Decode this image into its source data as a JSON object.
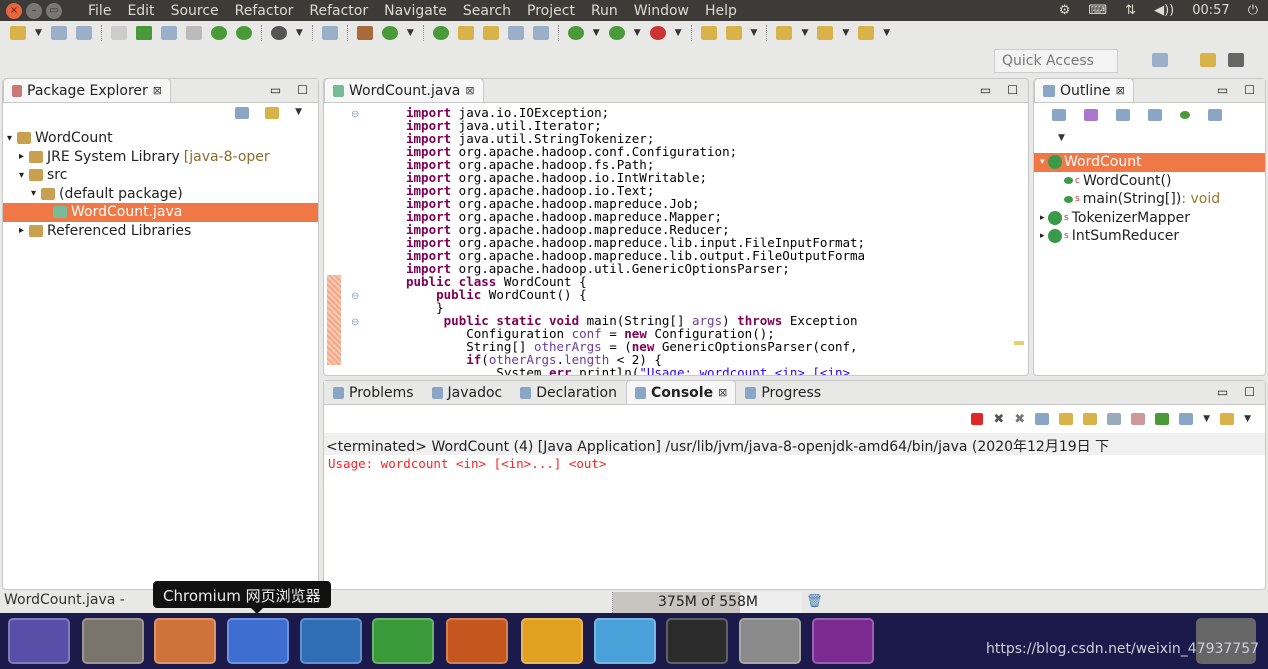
{
  "window": {
    "close": "×",
    "minimize": "–",
    "maximize": "▭"
  },
  "menu": [
    "File",
    "Edit",
    "Source",
    "Refactor",
    "Refactor",
    "Navigate",
    "Search",
    "Project",
    "Run",
    "Window",
    "Help"
  ],
  "tray": {
    "clock": "00:57",
    "volume": "◀))"
  },
  "quick_access": {
    "placeholder": "Quick Access"
  },
  "package_explorer": {
    "title": "Package Explorer",
    "tree": [
      {
        "label": "WordCount",
        "indent": 0,
        "arrow": "▾"
      },
      {
        "label": "JRE System Library",
        "suffix": "[java-8-oper",
        "indent": 1,
        "arrow": "▸"
      },
      {
        "label": "src",
        "indent": 1,
        "arrow": "▾"
      },
      {
        "label": "(default package)",
        "indent": 2,
        "arrow": "▾"
      },
      {
        "label": "WordCount.java",
        "indent": 3,
        "arrow": "",
        "selected": true
      },
      {
        "label": "Referenced Libraries",
        "indent": 1,
        "arrow": "▸"
      }
    ]
  },
  "editor": {
    "tab": "WordCount.java",
    "lines": [
      [
        [
          "kw",
          "import"
        ],
        [
          "pl",
          " java.io.IOException;"
        ]
      ],
      [
        [
          "kw",
          "import"
        ],
        [
          "pl",
          " java.util.Iterator;"
        ]
      ],
      [
        [
          "kw",
          "import"
        ],
        [
          "pl",
          " java.util.StringTokenizer;"
        ]
      ],
      [
        [
          "kw",
          "import"
        ],
        [
          "pl",
          " org.apache.hadoop.conf.Configuration;"
        ]
      ],
      [
        [
          "kw",
          "import"
        ],
        [
          "pl",
          " org.apache.hadoop.fs.Path;"
        ]
      ],
      [
        [
          "kw",
          "import"
        ],
        [
          "pl",
          " org.apache.hadoop.io.IntWritable;"
        ]
      ],
      [
        [
          "kw",
          "import"
        ],
        [
          "pl",
          " org.apache.hadoop.io.Text;"
        ]
      ],
      [
        [
          "kw",
          "import"
        ],
        [
          "pl",
          " org.apache.hadoop.mapreduce.Job;"
        ]
      ],
      [
        [
          "kw",
          "import"
        ],
        [
          "pl",
          " org.apache.hadoop.mapreduce.Mapper;"
        ]
      ],
      [
        [
          "kw",
          "import"
        ],
        [
          "pl",
          " org.apache.hadoop.mapreduce.Reducer;"
        ]
      ],
      [
        [
          "kw",
          "import"
        ],
        [
          "pl",
          " org.apache.hadoop.mapreduce.lib.input.FileInputFormat;"
        ]
      ],
      [
        [
          "kw",
          "import"
        ],
        [
          "pl",
          " org.apache.hadoop.mapreduce.lib.output.FileOutputForma"
        ]
      ],
      [
        [
          "kw",
          "import"
        ],
        [
          "pl",
          " org.apache.hadoop.util.GenericOptionsParser;"
        ]
      ],
      [
        [
          "kw",
          "public class"
        ],
        [
          "pl",
          " WordCount {"
        ]
      ],
      [
        [
          "pl",
          "    "
        ],
        [
          "kw",
          "public"
        ],
        [
          "pl",
          " WordCount() {"
        ]
      ],
      [
        [
          "pl",
          "    }"
        ]
      ],
      [
        [
          "pl",
          "     "
        ],
        [
          "kw",
          "public static void"
        ],
        [
          "pl",
          " main(String[] "
        ],
        [
          "var",
          "args"
        ],
        [
          "pl",
          ") "
        ],
        [
          "kw",
          "throws"
        ],
        [
          "pl",
          " Exception"
        ]
      ],
      [
        [
          "pl",
          "        Configuration "
        ],
        [
          "var",
          "conf"
        ],
        [
          "pl",
          " = "
        ],
        [
          "kw",
          "new"
        ],
        [
          "pl",
          " Configuration();"
        ]
      ],
      [
        [
          "pl",
          "        String[] "
        ],
        [
          "var",
          "otherArgs"
        ],
        [
          "pl",
          " = ("
        ],
        [
          "kw",
          "new"
        ],
        [
          "pl",
          " GenericOptionsParser(conf,"
        ]
      ],
      [
        [
          "pl",
          "        "
        ],
        [
          "kw",
          "if"
        ],
        [
          "pl",
          "("
        ],
        [
          "var",
          "otherArgs"
        ],
        [
          "pl",
          "."
        ],
        [
          "var",
          "length"
        ],
        [
          "pl",
          " < 2) {"
        ]
      ],
      [
        [
          "pl",
          "            System."
        ],
        [
          "kw",
          "err"
        ],
        [
          "pl",
          ".println("
        ],
        [
          "str",
          "\"Usage: wordcount <in> [<in>"
        ]
      ]
    ]
  },
  "outline": {
    "title": "Outline",
    "items": [
      {
        "label": "WordCount",
        "indent": 0,
        "arrow": "▾",
        "selected": true
      },
      {
        "label": "WordCount()",
        "sup": "c",
        "indent": 1
      },
      {
        "label": "main(String[])",
        "sup": "s",
        "type": " : void",
        "indent": 1
      },
      {
        "label": "TokenizerMapper",
        "sup": "s",
        "indent": 0,
        "arrow": "▸"
      },
      {
        "label": "IntSumReducer",
        "sup": "s",
        "indent": 0,
        "arrow": "▸"
      }
    ]
  },
  "bottom": {
    "tabs": [
      "Problems",
      "Javadoc",
      "Declaration",
      "Console",
      "Progress"
    ],
    "active": "Console",
    "console_header": "<terminated> WordCount (4) [Java Application] /usr/lib/jvm/java-8-openjdk-amd64/bin/java (2020年12月19日 下",
    "console_output": "Usage: wordcount <in> [<in>...] <out>"
  },
  "status": {
    "left": "WordCount.java -",
    "heap": "375M of 558M",
    "heap_used_fraction": 0.67
  },
  "tooltip": "Chromium 网页浏览器",
  "dock": {
    "apps": [
      "ubuntu-dash",
      "files",
      "firefox",
      "chromium",
      "writer",
      "calc",
      "impress",
      "software-center",
      "ubuntu-one",
      "terminal",
      "help",
      "app"
    ],
    "watermark": "https://blog.csdn.net/weixin_47937757"
  },
  "colors": {
    "selection": "#f07746",
    "keyword": "#7f0055",
    "console_error": "#ff2020",
    "dock_bg": "#1c1a4a"
  }
}
